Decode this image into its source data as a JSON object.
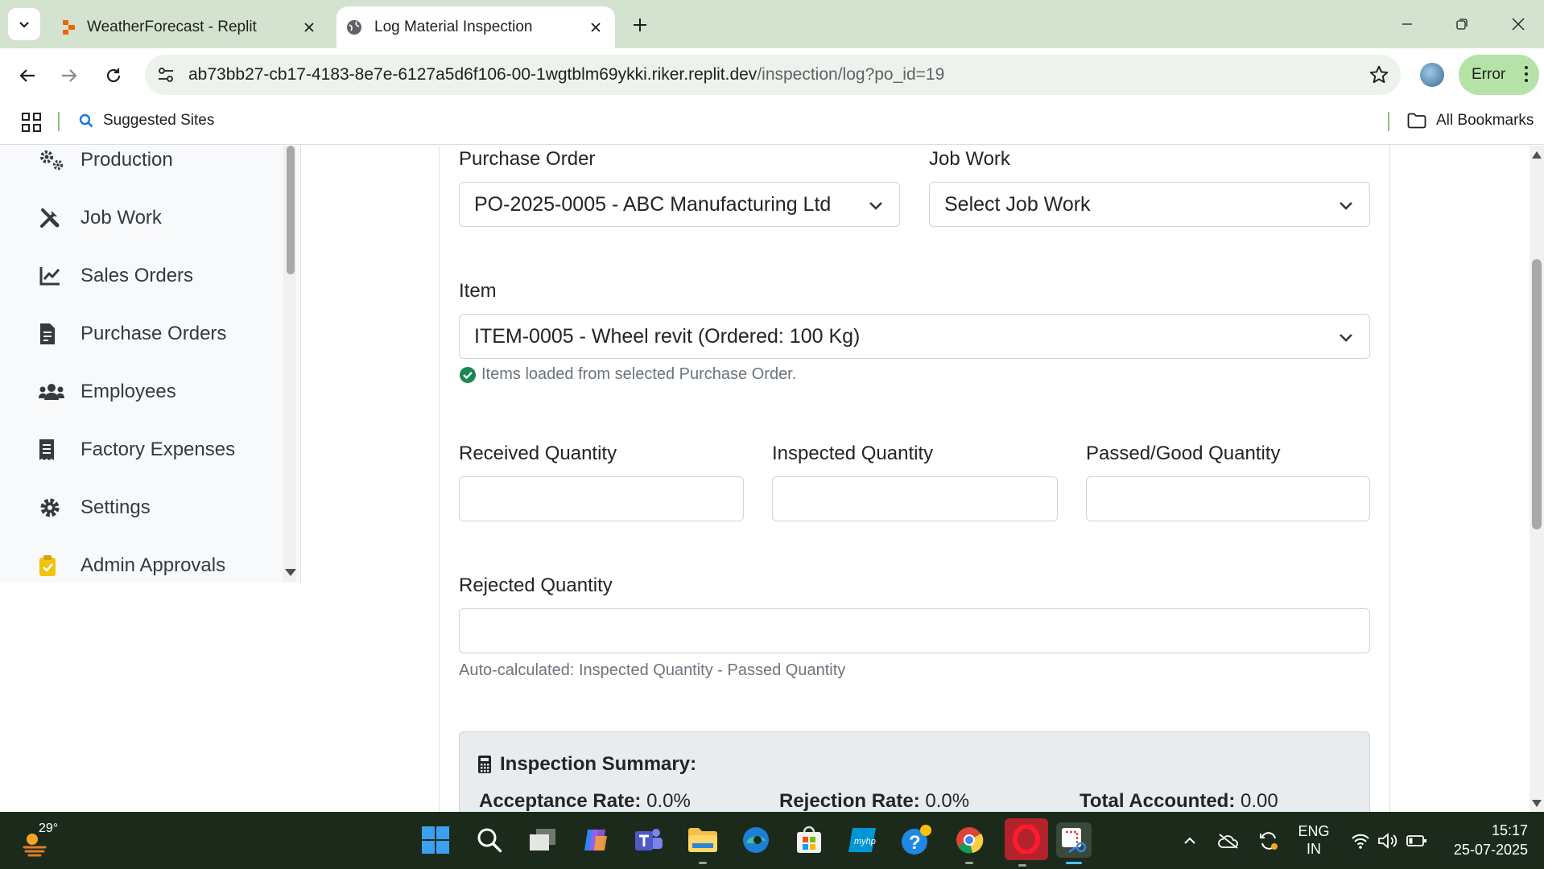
{
  "browser": {
    "tabs": [
      {
        "title": "WeatherForecast - Replit",
        "active": false
      },
      {
        "title": "Log Material Inspection",
        "active": true
      }
    ],
    "url_host": "ab73bb27-cb17-4183-8e7e-6127a5d6f106-00-1wgtblm69ykki.riker.replit.dev",
    "url_path": "/inspection/log?po_id=19",
    "status_pill": "Error",
    "bookmarks": {
      "suggested": "Suggested Sites",
      "all": "All Bookmarks"
    }
  },
  "sidebar": {
    "items": [
      {
        "label": "Production",
        "icon": "gears-icon"
      },
      {
        "label": "Job Work",
        "icon": "tools-icon"
      },
      {
        "label": "Sales Orders",
        "icon": "chart-line-icon"
      },
      {
        "label": "Purchase Orders",
        "icon": "file-invoice-icon"
      },
      {
        "label": "Employees",
        "icon": "users-icon"
      },
      {
        "label": "Factory Expenses",
        "icon": "receipt-icon"
      },
      {
        "label": "Settings",
        "icon": "gear-icon"
      },
      {
        "label": "Admin Approvals",
        "icon": "clipboard-check-icon"
      }
    ]
  },
  "form": {
    "purchase_order": {
      "label": "Purchase Order",
      "value": "PO-2025-0005 - ABC Manufacturing Ltd"
    },
    "job_work": {
      "label": "Job Work",
      "value": "Select Job Work"
    },
    "item": {
      "label": "Item",
      "value": "ITEM-0005 - Wheel revit (Ordered: 100 Kg)",
      "hint": "Items loaded from selected Purchase Order."
    },
    "received_quantity": {
      "label": "Received Quantity",
      "value": ""
    },
    "inspected_quantity": {
      "label": "Inspected Quantity",
      "value": ""
    },
    "passed_quantity": {
      "label": "Passed/Good Quantity",
      "value": ""
    },
    "rejected_quantity": {
      "label": "Rejected Quantity",
      "value": "",
      "hint": "Auto-calculated: Inspected Quantity - Passed Quantity"
    }
  },
  "summary": {
    "title": "Inspection Summary:",
    "acceptance_label": "Acceptance Rate:",
    "acceptance_value": "0.0%",
    "rejection_label": "Rejection Rate:",
    "rejection_value": "0.0%",
    "total_label": "Total Accounted:",
    "total_value": "0.00"
  },
  "taskbar": {
    "weather_temp": "29°",
    "lang_line1": "ENG",
    "lang_line2": "IN",
    "time": "15:17",
    "date": "25-07-2025"
  },
  "colors": {
    "chrome_tab_strip": "#d3e3cf",
    "omnibox": "#eef2ec",
    "error_pill": "#b5e3a7",
    "success": "#198754",
    "taskbar": "#1c2a1c"
  }
}
